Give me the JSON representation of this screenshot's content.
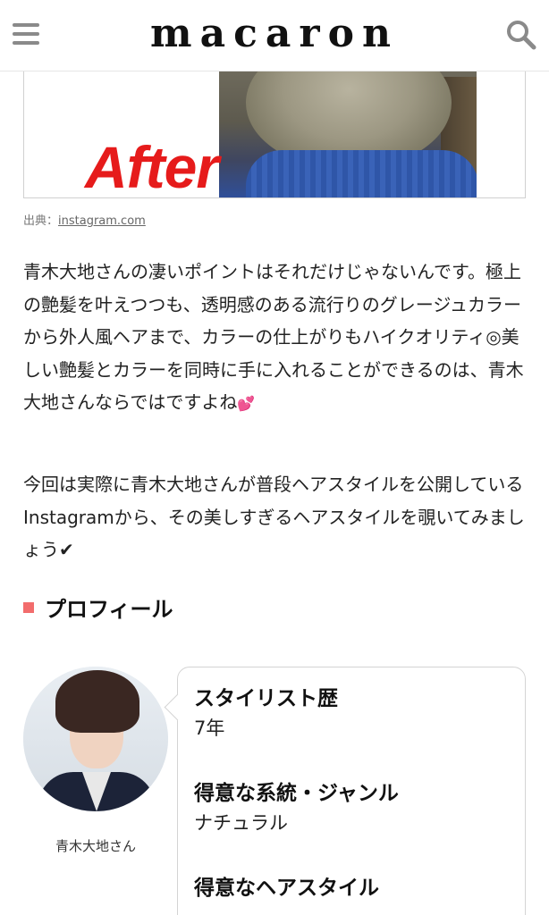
{
  "header": {
    "logo": "macaron",
    "menu_icon": "hamburger-menu-icon",
    "search_icon": "search-icon"
  },
  "image": {
    "overlay_text": "After"
  },
  "source": {
    "prefix": "出典：",
    "link_text": "instagram.com"
  },
  "article": {
    "paragraph1": "青木大地さんの凄いポイントはそれだけじゃないんです。極上の艶髪を叶えつつも、透明感のある流行りのグレージュカラーから外人風ヘアまで、カラーの仕上がりもハイクオリティ◎美しい艶髪とカラーを同時に手に入れることができるのは、青木大地さんならではですよね",
    "paragraph1_emoji": "💕",
    "paragraph2": "今回は実際に青木大地さんが普段ヘアスタイルを公開しているInstagramから、その美しすぎるヘアスタイルを覗いてみましょう✔"
  },
  "profile_section": {
    "title": "プロフィール",
    "marker_color": "#f26c6c",
    "stylist_name": "青木大地さん",
    "items": [
      {
        "label": "スタイリスト歴",
        "value": "7年"
      },
      {
        "label": "得意な系統・ジャンル",
        "value": "ナチュラル"
      },
      {
        "label": "得意なヘアスタイル",
        "value": ""
      }
    ]
  }
}
